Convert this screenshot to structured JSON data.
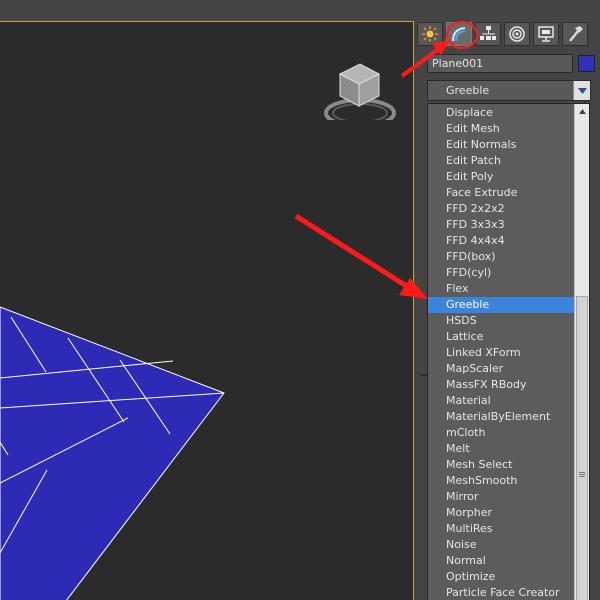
{
  "viewport": {
    "label": "",
    "plane_color": "#2d2ab6",
    "grid_line_color": "#ffffff",
    "border_color": "#c9a33a"
  },
  "command_panel": {
    "tabs": [
      {
        "name": "create-tab",
        "icon": "sun-star-icon"
      },
      {
        "name": "modify-tab",
        "icon": "modifier-bend-icon",
        "active": true
      },
      {
        "name": "hierarchy-tab",
        "icon": "hierarchy-icon"
      },
      {
        "name": "motion-tab",
        "icon": "motion-icon"
      },
      {
        "name": "display-tab",
        "icon": "monitor-icon"
      },
      {
        "name": "utilities-tab",
        "icon": "hammer-icon"
      }
    ],
    "object_name": "Plane001",
    "object_color": "#3030b8",
    "modifier_list_value": "Greeble"
  },
  "modifier_list": {
    "selected": "Greeble",
    "items": [
      "Displace",
      "Edit Mesh",
      "Edit Normals",
      "Edit Patch",
      "Edit Poly",
      "Face Extrude",
      "FFD 2x2x2",
      "FFD 3x3x3",
      "FFD 4x4x4",
      "FFD(box)",
      "FFD(cyl)",
      "Flex",
      "Greeble",
      "HSDS",
      "Lattice",
      "Linked XForm",
      "MapScaler",
      "MassFX RBody",
      "Material",
      "MaterialByElement",
      "mCloth",
      "Melt",
      "Mesh Select",
      "MeshSmooth",
      "Mirror",
      "Morpher",
      "MultiRes",
      "Noise",
      "Normal",
      "Optimize",
      "Particle Face Creator"
    ]
  },
  "annotations": {
    "arrow_color": "#ff1a1a",
    "circle_color": "#ff1a1a"
  }
}
